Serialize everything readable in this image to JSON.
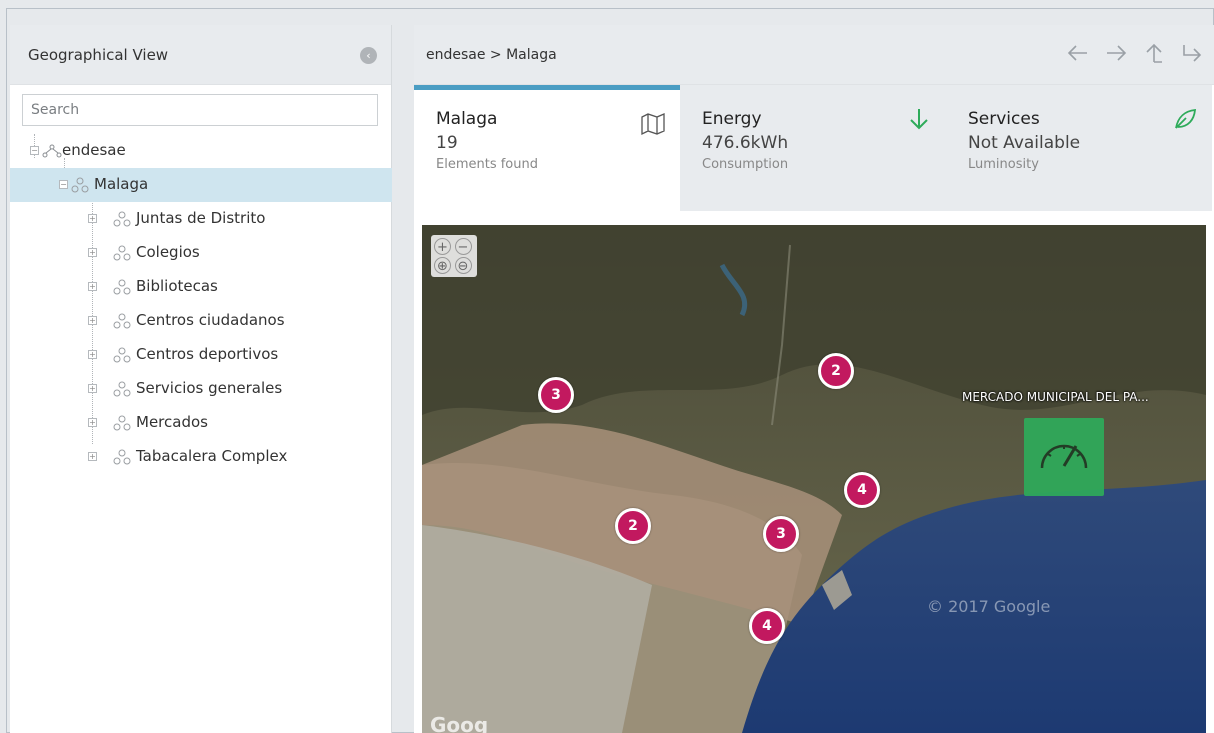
{
  "left": {
    "title": "Geographical View",
    "search_placeholder": "Search",
    "tree": {
      "root": "endesae",
      "child": "Malaga",
      "items": [
        "Juntas de Distrito",
        "Colegios",
        "Bibliotecas",
        "Centros ciudadanos",
        "Centros deportivos",
        "Servicios generales",
        "Mercados",
        "Tabacalera Complex"
      ]
    }
  },
  "right": {
    "breadcrumb": "endesae > Malaga",
    "nav_icons": [
      "back-arrow-icon",
      "forward-arrow-icon",
      "up-arrow-icon",
      "share-arrow-icon"
    ],
    "cards": [
      {
        "title": "Malaga",
        "value": "19",
        "sub": "Elements found",
        "icon": "map-icon"
      },
      {
        "title": "Energy",
        "value": "476.6kWh",
        "sub": "Consumption",
        "icon": "arrow-down-icon"
      },
      {
        "title": "Services",
        "value": "Not Available",
        "sub": "Luminosity",
        "icon": "leaf-icon"
      }
    ],
    "map": {
      "clusters": [
        "3",
        "2",
        "2",
        "4",
        "3",
        "4"
      ],
      "poi_label": "MERCADO MUNICIPAL DEL PA...",
      "copyright": "© 2017 Google",
      "logo": "Goog"
    }
  },
  "colors": {
    "accent": "#4a9dc3",
    "cluster": "#c2195f",
    "green": "#2eab5a",
    "selected_row": "#cfe5ef"
  }
}
